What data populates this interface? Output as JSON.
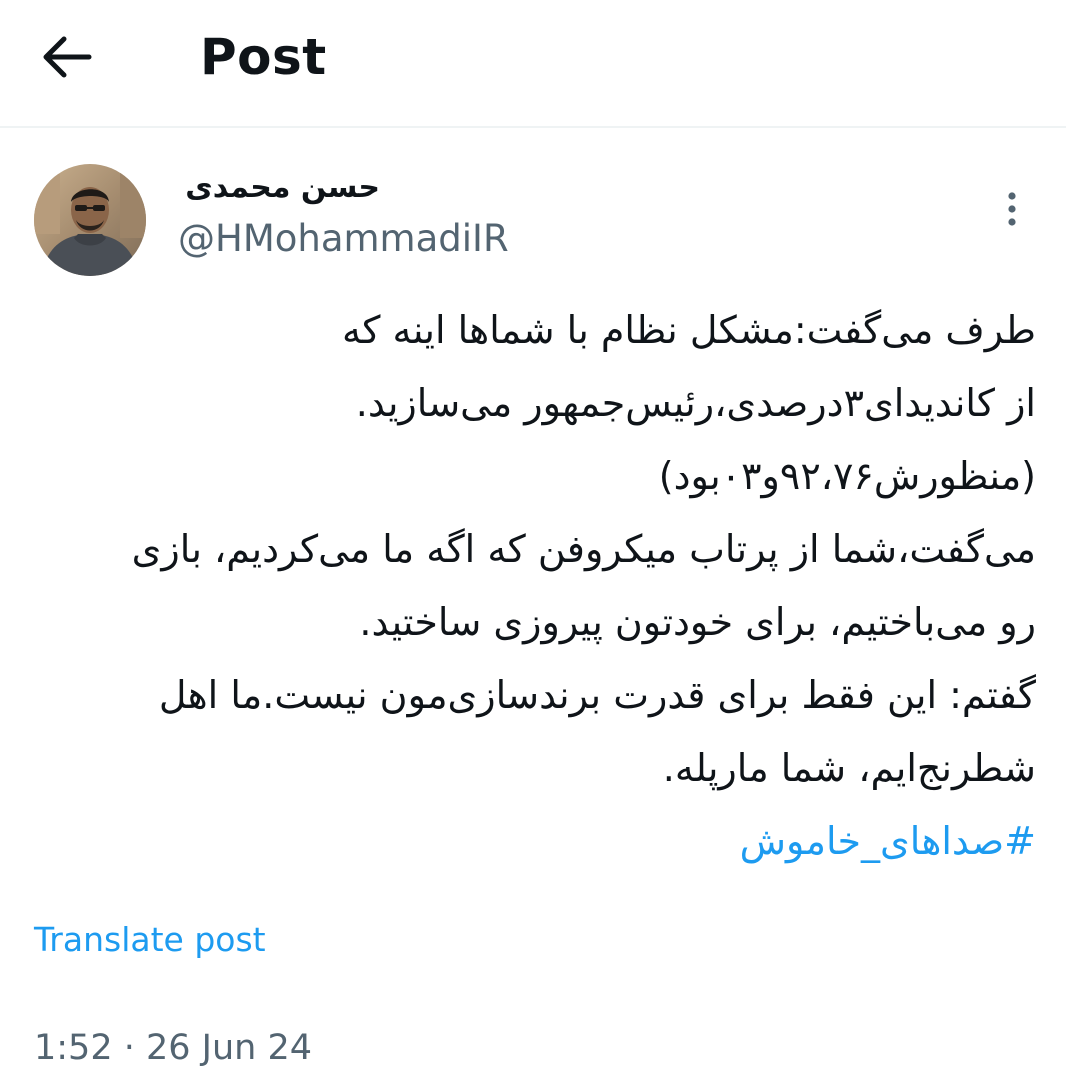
{
  "header": {
    "title": "Post",
    "back_icon": "arrow-left-icon"
  },
  "author": {
    "display_name": "حسن محمدی",
    "handle": "@HMohammadiIR",
    "avatar_icon": "profile-photo",
    "more_icon": "more-vertical-icon"
  },
  "tweet": {
    "lines": [
      "طرف می‌گفت:مشکل نظام با شماها اینه که",
      "از کاندیدای۳درصدی،رئیس‌جمهور می‌سازید.",
      "(منظورش۹۲،۷۶و۰۳بود)",
      "می‌گفت،شما از پرتاب میکروفن که اگه ما می‌کردیم، بازی",
      "رو می‌باختیم، برای خودتون پیروزی ساختید.",
      "گفتم: این فقط برای قدرت برندسازی‌مون نیست.ما اهل",
      "شطرنج‌ایم، شما مارپله."
    ],
    "hashtag": "#صداهای_خاموش",
    "hashtag_color": "#1d9bf0"
  },
  "translate_label": "Translate post",
  "timestamp": "1:52 · 26 Jun 24",
  "colors": {
    "text": "#0f1419",
    "secondary": "#536471",
    "accent": "#1d9bf0",
    "divider": "#eff3f4"
  }
}
